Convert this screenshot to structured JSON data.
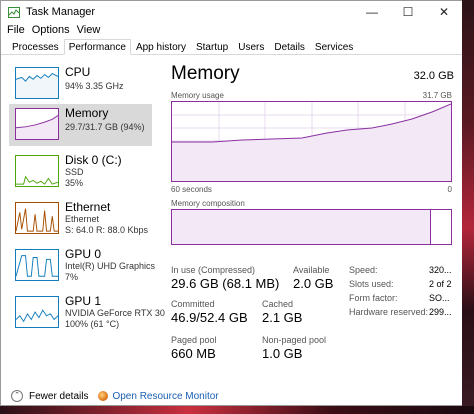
{
  "window": {
    "title": "Task Manager"
  },
  "menu": [
    "File",
    "Options",
    "View"
  ],
  "tabs": [
    "Processes",
    "Performance",
    "App history",
    "Startup",
    "Users",
    "Details",
    "Services"
  ],
  "sidebar": [
    {
      "name": "CPU",
      "sub1": "94%  3.35 GHz",
      "sub2": "",
      "color": "#117dbb"
    },
    {
      "name": "Memory",
      "sub1": "29.7/31.7 GB (94%)",
      "sub2": "",
      "color": "#8b2fa0"
    },
    {
      "name": "Disk 0 (C:)",
      "sub1": "SSD",
      "sub2": "35%",
      "color": "#4da60c"
    },
    {
      "name": "Ethernet",
      "sub1": "Ethernet",
      "sub2": "S: 64.0  R: 88.0 Kbps",
      "color": "#a74f01"
    },
    {
      "name": "GPU 0",
      "sub1": "Intel(R) UHD Graphics",
      "sub2": "7%",
      "color": "#117dbb"
    },
    {
      "name": "GPU 1",
      "sub1": "NVIDIA GeForce RTX 30",
      "sub2": "100%  (61 °C)",
      "color": "#117dbb"
    }
  ],
  "main": {
    "title": "Memory",
    "total": "32.0 GB",
    "usage_label": "Memory usage",
    "usage_max": "31.7 GB",
    "time_left": "60 seconds",
    "time_right": "0",
    "composition_label": "Memory composition",
    "composition_in_use_fraction": 0.93
  },
  "stats": {
    "in_use_label": "In use (Compressed)",
    "in_use_value": "29.6 GB (68.1 MB)",
    "available_label": "Available",
    "available_value": "2.0 GB",
    "committed_label": "Committed",
    "committed_value": "46.9/52.4 GB",
    "cached_label": "Cached",
    "cached_value": "2.1 GB",
    "paged_label": "Paged pool",
    "paged_value": "660 MB",
    "nonpaged_label": "Non-paged pool",
    "nonpaged_value": "1.0 GB"
  },
  "details": [
    {
      "label": "Speed:",
      "value": "320..."
    },
    {
      "label": "Slots used:",
      "value": "2 of 2"
    },
    {
      "label": "Form factor:",
      "value": "SO..."
    },
    {
      "label": "Hardware reserved:",
      "value": "299..."
    }
  ],
  "footer": {
    "fewer": "Fewer details",
    "monitor": "Open Resource Monitor"
  },
  "colors": {
    "memory_accent": "#8b2fa0",
    "link": "#1a5fb4",
    "selected_bg": "#d9d9d9"
  }
}
